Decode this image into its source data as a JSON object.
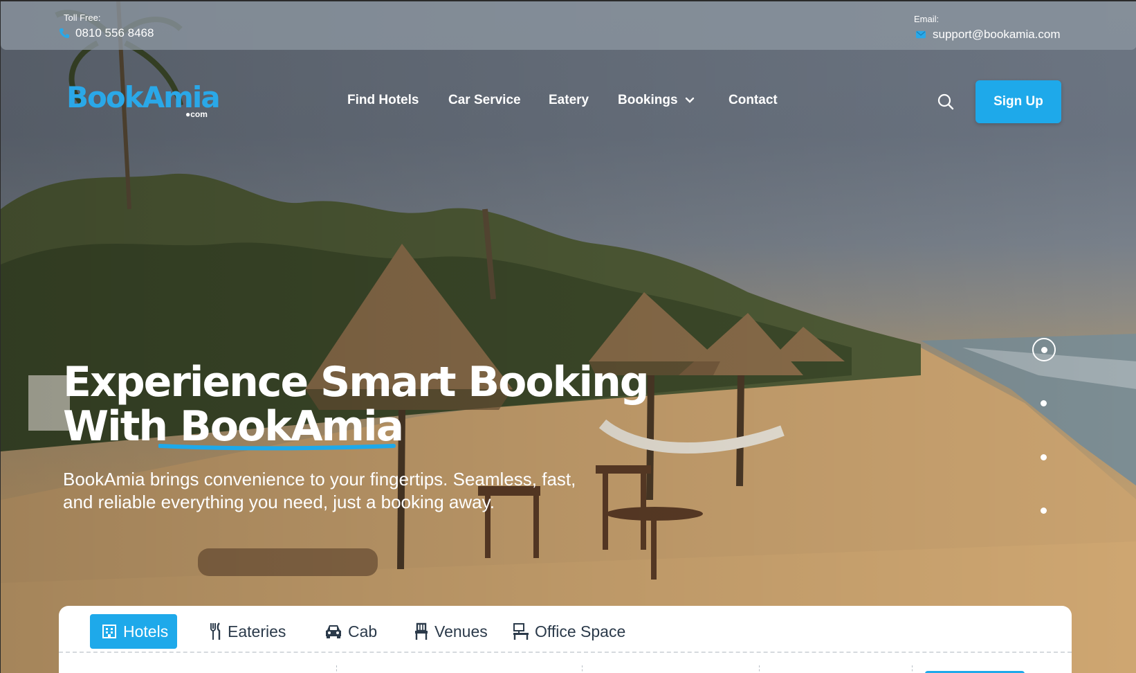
{
  "topbar": {
    "toll_label": "Toll Free:",
    "toll_number": "0810 556 8468",
    "email_label": "Email:",
    "email_value": "support@bookamia.com"
  },
  "brand": {
    "name": "BookAmia",
    "suffix": "●com",
    "accent": "#1ea9ea"
  },
  "nav": {
    "items": [
      "Find Hotels",
      "Car Service",
      "Eatery",
      "Bookings",
      "Contact"
    ],
    "signup_label": "Sign Up"
  },
  "hero": {
    "headline_line1": "Experience Smart Booking",
    "headline_line2_prefix": "With",
    "headline_brand": "BookAmia",
    "subtext": "BookAmia brings convenience to your fingertips. Seamless, fast, and reliable everything you need, just a booking away.",
    "slider": {
      "count": 4,
      "active": 1
    }
  },
  "booking": {
    "tabs": [
      {
        "label": "Hotels",
        "icon": "building-icon",
        "active": true
      },
      {
        "label": "Eateries",
        "icon": "utensils-icon",
        "active": false
      },
      {
        "label": "Cab",
        "icon": "car-icon",
        "active": false
      },
      {
        "label": "Venues",
        "icon": "chair-icon",
        "active": false
      },
      {
        "label": "Office Space",
        "icon": "desk-icon",
        "active": false
      }
    ]
  }
}
